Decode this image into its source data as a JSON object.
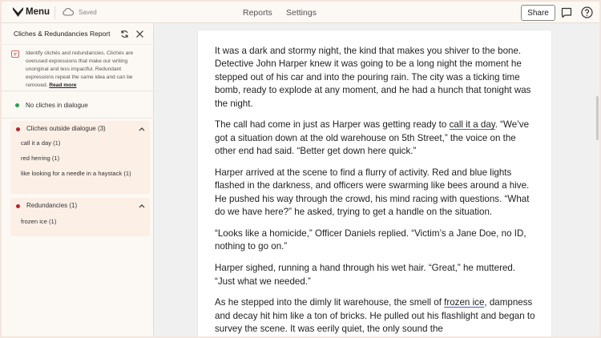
{
  "topbar": {
    "menu_label": "Menu",
    "saved_label": "Saved",
    "nav_reports": "Reports",
    "nav_settings": "Settings",
    "share_label": "Share"
  },
  "sidebar": {
    "title": "Cliches & Redundancies Report",
    "description": "Identify clichés and redundancies. Clichés are overused expressions that make our writing unoriginal and less impactful. Redundant expressions repeat the same idea and can be removed.",
    "read_more": "Read more",
    "dialogue_status": "No cliches in dialogue",
    "outside_header": "Cliches outside dialogue (3)",
    "outside_items": [
      "call it a day (1)",
      "red herring (1)",
      "like looking for a needle in a haystack (1)"
    ],
    "redundancies_header": "Redundancies (1)",
    "redundancy_items": [
      "frozen ice (1)"
    ]
  },
  "colors": {
    "green_dot": "#2e9e4f",
    "red_dot": "#b3262e",
    "highlight_underline": "#4a5dbf",
    "card_bg": "#fbefe6"
  },
  "document": {
    "p1": "It was a dark and stormy night, the kind that makes you shiver to the bone. Detective John Harper knew it was going to be a long night the moment he stepped out of his car and into the pouring rain. The city was a ticking time bomb, ready to explode at any moment, and he had a hunch that tonight was the night.",
    "p2_a": "The call had come in just as Harper was getting ready to ",
    "p2_hl": "call it a day",
    "p2_b": ". “We’ve got a situation down at the old warehouse on 5th Street,” the voice on the other end had said. “Better get down here quick.”",
    "p3": "Harper arrived at the scene to find a flurry of activity. Red and blue lights flashed in the darkness, and officers were swarming like bees around a hive. He pushed his way through the crowd, his mind racing with questions. “What do we have here?” he asked, trying to get a handle on the situation.",
    "p4": "“Looks like a homicide,” Officer Daniels replied. “Victim’s a Jane Doe, no ID, nothing to go on.”",
    "p5": "Harper sighed, running a hand through his wet hair. “Great,” he muttered. “Just what we needed.”",
    "p6_a": "As he stepped into the dimly lit warehouse, the smell of ",
    "p6_hl": "frozen ice",
    "p6_b": ", dampness and decay hit him like a ton of bricks. He pulled out his flashlight and began to survey the scene. It was eerily quiet, the only sound the"
  }
}
